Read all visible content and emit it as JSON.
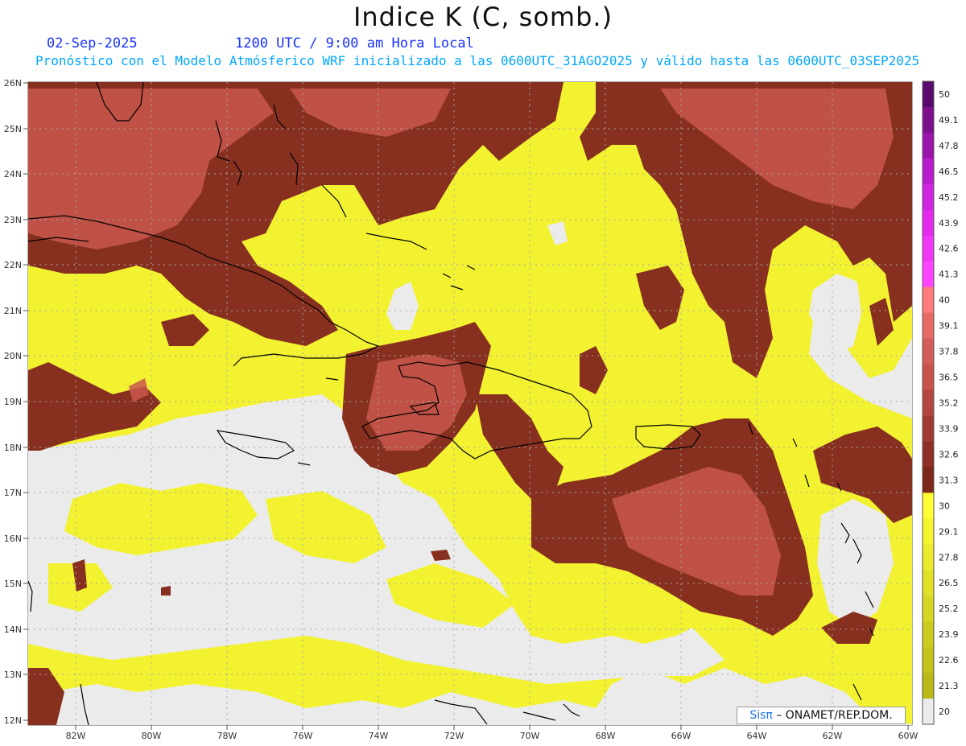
{
  "header": {
    "title": "Indice K (C, somb.)",
    "date": "02-Sep-2025",
    "time": "1200 UTC / 9:00 am Hora Local",
    "forecast": "Pronóstico con el Modelo Atmósferico WRF inicializado a las 0600UTC_31AGO2025 y válido hasta las  0600UTC_03SEP2025"
  },
  "axes": {
    "lat_labels": [
      "26N",
      "25N",
      "24N",
      "23N",
      "22N",
      "21N",
      "20N",
      "19N",
      "18N",
      "17N",
      "16N",
      "15N",
      "14N",
      "13N",
      "12N"
    ],
    "lon_labels": [
      "82W",
      "80W",
      "78W",
      "76W",
      "74W",
      "72W",
      "70W",
      "68W",
      "66W",
      "64W",
      "62W",
      "60W"
    ],
    "lat_range": [
      12,
      26
    ],
    "lon_range": [
      -83.2,
      -60
    ]
  },
  "legend": {
    "levels": [
      "50",
      "49.1",
      "47.8",
      "46.5",
      "45.2",
      "43.9",
      "42.6",
      "41.3",
      "40",
      "39.1",
      "37.8",
      "36.5",
      "35.2",
      "33.9",
      "32.6",
      "31.3",
      "30",
      "29.1",
      "27.8",
      "26.5",
      "25.2",
      "23.9",
      "22.6",
      "21.3",
      "20"
    ],
    "colors": [
      "#5a0a6e",
      "#7d0f8f",
      "#9c14ad",
      "#b81ccc",
      "#cf24e0",
      "#e52af0",
      "#f236f5",
      "#ff44ff",
      "#ff7b7b",
      "#e86a66",
      "#d45c58",
      "#c9524d",
      "#b7453f",
      "#a33a33",
      "#8f2f28",
      "#7d2818",
      "#ffff33",
      "#f5f52f",
      "#ebeb2b",
      "#e0e027",
      "#d6d623",
      "#cccc1f",
      "#c2c21b",
      "#b8b817"
    ],
    "position": "right"
  },
  "colors": {
    "below": "#ebebeb",
    "yellow": "#f2f231",
    "brown": "#87301f",
    "red": "#c9574d",
    "coast": "#000000"
  },
  "credit": {
    "sis": "Sisπ",
    "rest": "– ONAMET/REP.DOM."
  }
}
